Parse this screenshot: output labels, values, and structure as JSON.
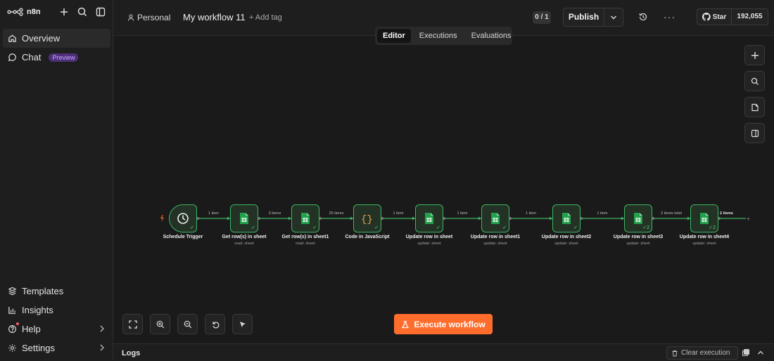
{
  "app": {
    "logo_text": "n8n"
  },
  "sidebar": {
    "items_top": [
      {
        "label": "Overview",
        "icon": "home-icon"
      },
      {
        "label": "Chat",
        "icon": "chat-icon",
        "badge": "Preview"
      }
    ],
    "items_bottom": [
      {
        "label": "Templates",
        "icon": "templates-icon"
      },
      {
        "label": "Insights",
        "icon": "insights-icon"
      },
      {
        "label": "Help",
        "icon": "help-icon"
      },
      {
        "label": "Settings",
        "icon": "settings-icon"
      }
    ]
  },
  "header": {
    "project": "Personal",
    "workflow_name": "My workflow 11",
    "add_tag": "+ Add tag",
    "counter": "0 / 1",
    "publish": "Publish",
    "github_star": "Star",
    "github_count": "192,055"
  },
  "tabs": [
    {
      "label": "Editor",
      "active": true
    },
    {
      "label": "Executions",
      "active": false
    },
    {
      "label": "Evaluations",
      "active": false
    }
  ],
  "workflow": {
    "nodes": [
      {
        "name": "Schedule Trigger",
        "sub": "",
        "type": "trigger"
      },
      {
        "name": "Get row(s) in sheet",
        "sub": "read: sheet",
        "type": "sheet"
      },
      {
        "name": "Get row(s) in sheet1",
        "sub": "read: sheet",
        "type": "sheet"
      },
      {
        "name": "Code in JavaScript",
        "sub": "",
        "type": "code"
      },
      {
        "name": "Update row in sheet",
        "sub": "update: sheet",
        "type": "sheet"
      },
      {
        "name": "Update row in sheet1",
        "sub": "update: sheet",
        "type": "sheet"
      },
      {
        "name": "Update row in sheet2",
        "sub": "update: sheet",
        "type": "sheet"
      },
      {
        "name": "Update row in sheet3",
        "sub": "update: sheet",
        "type": "sheet",
        "count": "2"
      },
      {
        "name": "Update row in sheet4",
        "sub": "update: sheet",
        "type": "sheet",
        "count": "2"
      }
    ],
    "edges": [
      "1 item",
      "3 items",
      "25 items",
      "1 item",
      "1 item",
      "1 item",
      "1 item",
      "2 items total",
      "2 items"
    ]
  },
  "execute_button": "Execute workflow",
  "logs": {
    "label": "Logs",
    "clear": "Clear execution"
  },
  "colors": {
    "accent": "#ff6d2d",
    "success": "#3cb563",
    "sheet": "#22a04b",
    "background": "#1a1a1a"
  }
}
